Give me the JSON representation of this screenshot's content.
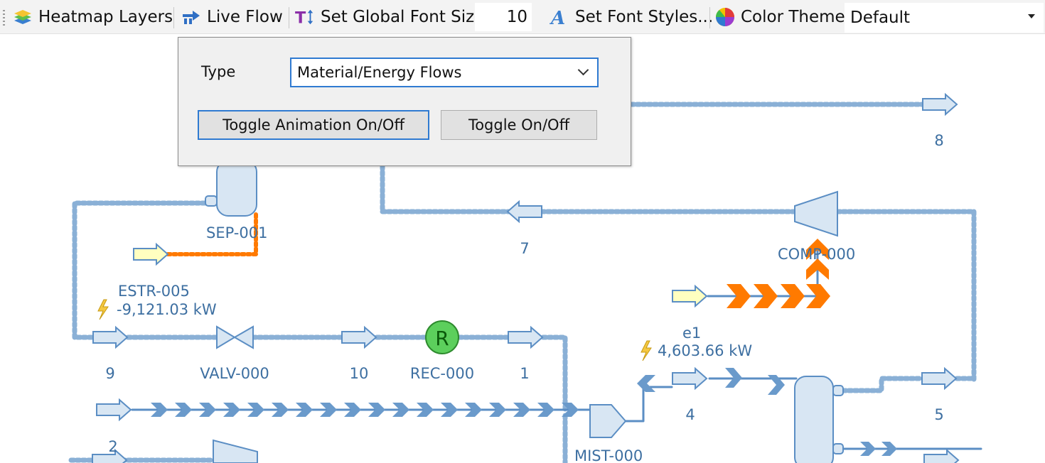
{
  "toolbar": {
    "heatmap_label": "Heatmap Layers",
    "liveflow_label": "Live Flow",
    "fontsize_label": "Set Global Font Size",
    "fontsize_value": "10",
    "fontstyles_label": "Set Font Styles...",
    "colortheme_label": "Color Theme",
    "colortheme_value": "Default"
  },
  "popup": {
    "type_label": "Type",
    "type_value": "Material/Energy Flows",
    "toggle_animation_label": "Toggle Animation On/Off",
    "toggle_label": "Toggle On/Off"
  },
  "diagram": {
    "units": {
      "sep": "SEP-001",
      "estr": "ESTR-005",
      "estr_power": "-9,121.03 kW",
      "valve": "VALV-000",
      "reactor": "REC-000",
      "reactor_symbol": "R",
      "compressor": "COMP-000",
      "mixer": "MIST-000",
      "energy": "e1",
      "energy_power": "4,603.66 kW"
    },
    "streams": {
      "s8": "8",
      "s7": "7",
      "s9": "9",
      "s10": "10",
      "s1": "1",
      "s4": "4",
      "s5": "5",
      "s2": "2"
    }
  },
  "colors": {
    "stream_blue": "#5b8ec4",
    "unit_fill": "#d8e6f3",
    "energy_orange": "#ff7a00",
    "label_blue": "#3d6fa1",
    "reactor_green": "#5ccf5c",
    "focus_blue": "#2f7ad1"
  }
}
